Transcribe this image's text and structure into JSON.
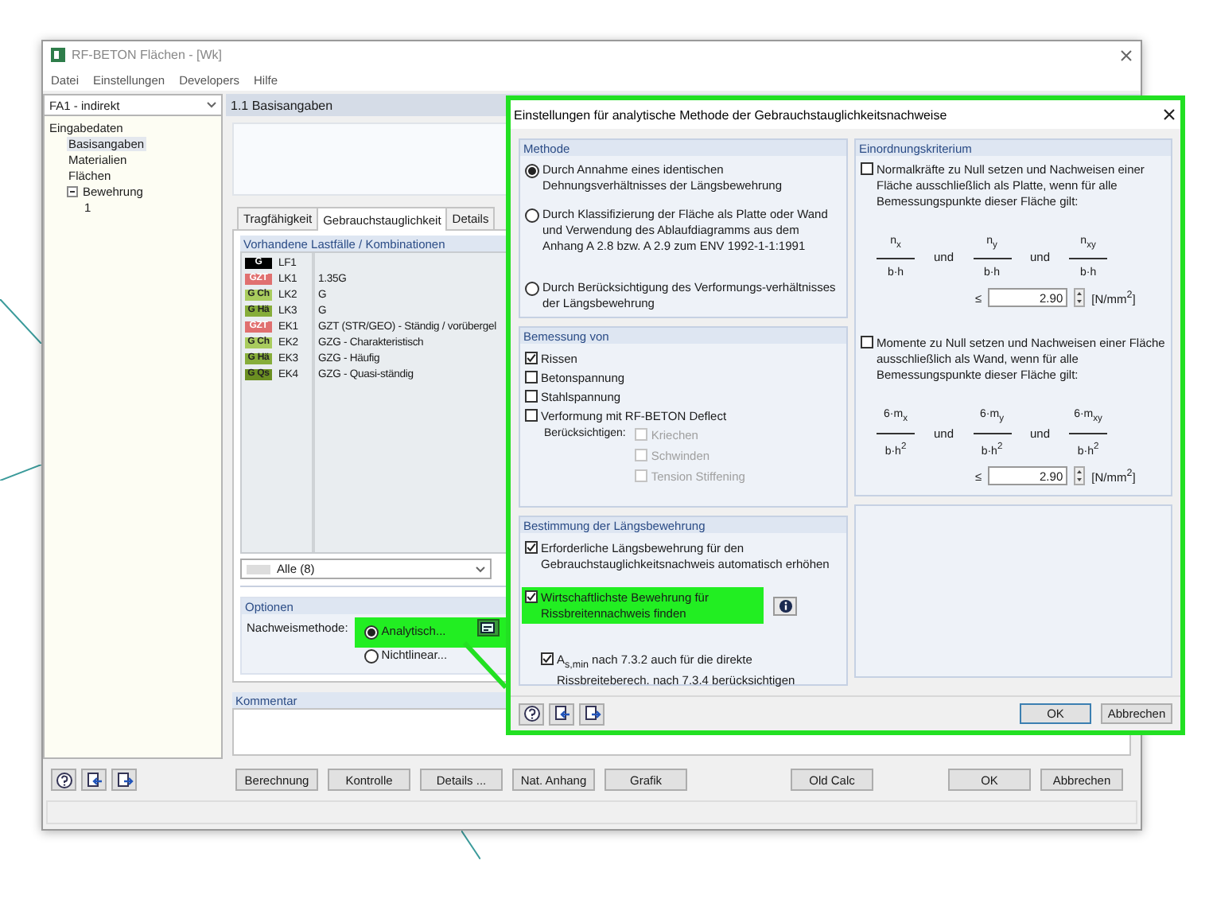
{
  "window": {
    "title": "RF-BETON Flächen - [Wk]"
  },
  "menu": [
    "Datei",
    "Einstellungen",
    "Developers",
    "Hilfe"
  ],
  "case_selector": {
    "value": "FA1 - indirekt"
  },
  "tree": [
    {
      "label": "Eingabedaten",
      "selected": false,
      "children": [
        {
          "label": "Basisangaben",
          "selected": true
        },
        {
          "label": "Materialien",
          "selected": false
        },
        {
          "label": "Flächen",
          "selected": false
        },
        {
          "label": "Bewehrung",
          "selected": false,
          "children": [
            {
              "label": "1",
              "selected": false
            }
          ]
        }
      ]
    }
  ],
  "section_header": "1.1 Basisangaben",
  "tabs": [
    {
      "label": "Tragfähigkeit",
      "selected": false
    },
    {
      "label": "Gebrauchstauglichkeit",
      "selected": true
    },
    {
      "label": "Details",
      "selected": false
    }
  ],
  "load_cases": {
    "title": "Vorhandene Lastfälle / Kombinationen",
    "rows": [
      {
        "badge": "G",
        "color": "#000000",
        "name": "LF1"
      },
      {
        "badge": "GZT",
        "color": "#e07070",
        "name": "LK1",
        "description": "1.35G"
      },
      {
        "badge": "G Ch",
        "color": "#a9cc5e",
        "name": "LK2",
        "description": "G"
      },
      {
        "badge": "G Hä",
        "color": "#86ad3a",
        "name": "LK3",
        "description": "G"
      },
      {
        "badge": "GZT",
        "color": "#e07070",
        "name": "EK1",
        "description": "GZT (STR/GEO) - Ständig / vorübergel"
      },
      {
        "badge": "G Ch",
        "color": "#a9cc5e",
        "name": "EK2",
        "description": "GZG - Charakteristisch"
      },
      {
        "badge": "G Hä",
        "color": "#86ad3a",
        "name": "EK3",
        "description": "GZG - Häufig"
      },
      {
        "badge": "G Qs",
        "color": "#6b8f22",
        "name": "EK4",
        "description": "GZG - Quasi-ständig"
      }
    ],
    "filter": {
      "value": "Alle (8)"
    }
  },
  "options": {
    "title": "Optionen",
    "label": "Nachweismethode:",
    "highlighted": true,
    "methods": [
      {
        "label": "Analytisch...",
        "selected": true
      },
      {
        "label": "Nichtlinear...",
        "selected": false
      }
    ]
  },
  "comment": {
    "title": "Kommentar"
  },
  "footer": {
    "actions": [
      "Berechnung",
      "Kontrolle",
      "Details ...",
      "Nat. Anhang",
      "Grafik"
    ],
    "extra": [
      "Old Calc"
    ],
    "dialog": [
      "OK",
      "Abbrechen"
    ]
  },
  "dialog": {
    "title": "Einstellungen für analytische Methode der Gebrauchstauglichkeitsnachweise",
    "highlighted": true,
    "method": {
      "title": "Methode",
      "options": [
        {
          "label": "Durch Annahme eines identischen Dehnungsverhältnisses der Längsbewehrung",
          "selected": true
        },
        {
          "label": "Durch Klassifizierung der Fläche als Platte oder Wand und Verwendung des Ablaufdiagramms aus dem Anhang A 2.8 bzw. A 2.9 zum ENV 1992-1-1:1991",
          "selected": false
        },
        {
          "label": "Durch Berücksichtigung des Verformungs-verhältnisses der Längsbewehrung",
          "selected": false
        }
      ]
    },
    "design": {
      "title": "Bemessung von",
      "items": [
        {
          "label": "Rissen",
          "checked": true
        },
        {
          "label": "Betonspannung",
          "checked": false
        },
        {
          "label": "Stahlspannung",
          "checked": false
        },
        {
          "label": "Verformung mit RF-BETON Deflect",
          "checked": false
        }
      ],
      "consider": {
        "label": "Berücksichtigen:",
        "items": [
          {
            "label": "Kriechen",
            "checked": false,
            "disabled": true
          },
          {
            "label": "Schwinden",
            "checked": false,
            "disabled": true
          },
          {
            "label": "Tension Stiffening",
            "checked": false,
            "disabled": true
          }
        ]
      }
    },
    "reinforcement": {
      "title": "Bestimmung der Längsbewehrung",
      "items": [
        {
          "label": "Erforderliche Längsbewehrung für den Gebrauchstauglichkeitsnachweis automatisch erhöhen",
          "checked": true,
          "highlighted": false,
          "info": false
        },
        {
          "label": "Wirtschaftlichste Bewehrung für Rissbreitennachweis finden",
          "checked": true,
          "highlighted": true,
          "info": true,
          "children": [
            {
              "label": "A$_{s,min}$ nach 7.3.2 auch für die direkte Rissbreiteberech. nach 7.3.4 berücksichtigen",
              "checked": true
            }
          ]
        }
      ]
    },
    "criterion": {
      "title": "Einordnungskriterium",
      "rules": [
        {
          "label": "Normalkräfte zu Null setzen und Nachweisen einer Fläche ausschließlich als Platte, wenn für alle Bemessungspunkte dieser Fläche gilt:",
          "checked": false,
          "fractions": [
            {
              "numerator": "n$_{x}$",
              "denominator": "b·h"
            },
            {
              "numerator": "n$_{y}$",
              "denominator": "b·h"
            },
            {
              "numerator": "n$_{xy}$",
              "denominator": "b·h"
            }
          ],
          "connectors": [
            "und",
            "und"
          ],
          "relation": "≤",
          "value": "2.90",
          "unit": "[N/mm$^{2}$]"
        },
        {
          "label": "Momente zu Null setzen und Nachweisen einer Fläche ausschließlich als Wand, wenn für alle Bemessungspunkte dieser Fläche gilt:",
          "checked": false,
          "fractions": [
            {
              "numerator": "6·m$_{x}$",
              "denominator": "b·h$^{2}$"
            },
            {
              "numerator": "6·m$_{y}$",
              "denominator": "b·h$^{2}$"
            },
            {
              "numerator": "6·m$_{xy}$",
              "denominator": "b·h$^{2}$"
            }
          ],
          "connectors": [
            "und",
            "und"
          ],
          "relation": "≤",
          "value": "2.90",
          "unit": "[N/mm$^{2}$]"
        }
      ]
    },
    "buttons": [
      "OK",
      "Abbrechen"
    ]
  }
}
